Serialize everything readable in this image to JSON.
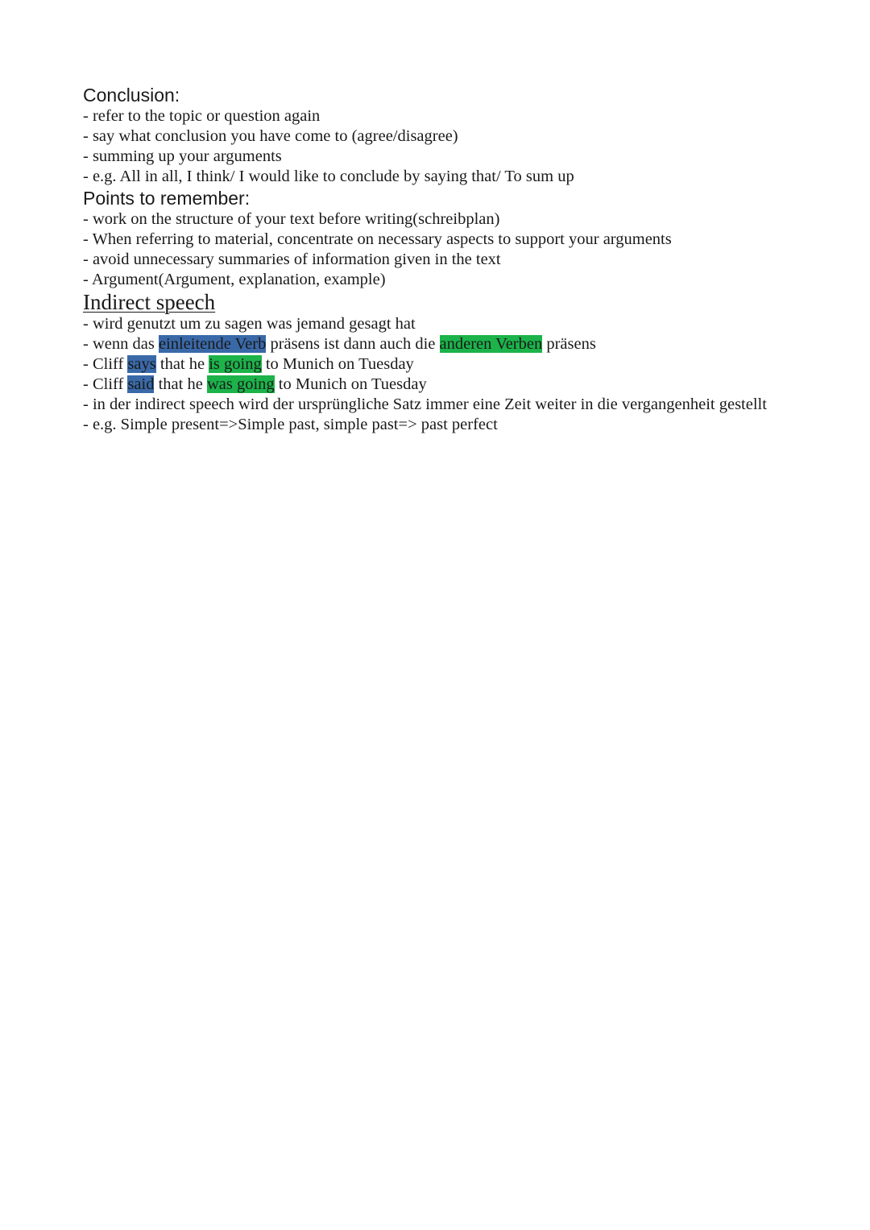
{
  "conclusion": {
    "heading": "Conclusion:",
    "items": [
      "- refer to the topic or question again",
      "- say what conclusion you have come to (agree/disagree)",
      "- summing up your arguments",
      "- e.g. All in all, I think/ I would like to conclude by saying that/ To sum up"
    ]
  },
  "points": {
    "heading": "Points to remember:",
    "items": [
      "- work on the structure of your text before writing(schreibplan)",
      "- When referring to material, concentrate on necessary aspects to support your arguments",
      "- avoid unnecessary summaries of information given in the text",
      "- Argument(Argument, explanation, example)"
    ]
  },
  "indirect": {
    "heading": "Indirect speech",
    "line1": "- wird genutzt um zu sagen was jemand gesagt hat",
    "line2": {
      "a": "- wenn das ",
      "hl1": "einleitende Verb",
      "b": " präsens ist dann auch die ",
      "hl2": "anderen Verben",
      "c": " präsens"
    },
    "line3": {
      "a": "- Cliff ",
      "hl1": "says",
      "b": " that he ",
      "hl2": "is going",
      "c": " to Munich on Tuesday"
    },
    "line4": {
      "a": "- Cliff ",
      "hl1": "said",
      "b": " that he ",
      "hl2": "was going",
      "c": " to Munich on Tuesday"
    },
    "line5": "- in der indirect speech wird der ursprüngliche Satz immer eine Zeit weiter in die vergangenheit gestellt",
    "line6": "- e.g. Simple present=>Simple past, simple past=> past perfect"
  },
  "colors": {
    "highlight_blue": "#3a69a8",
    "highlight_green": "#1cb34a"
  }
}
